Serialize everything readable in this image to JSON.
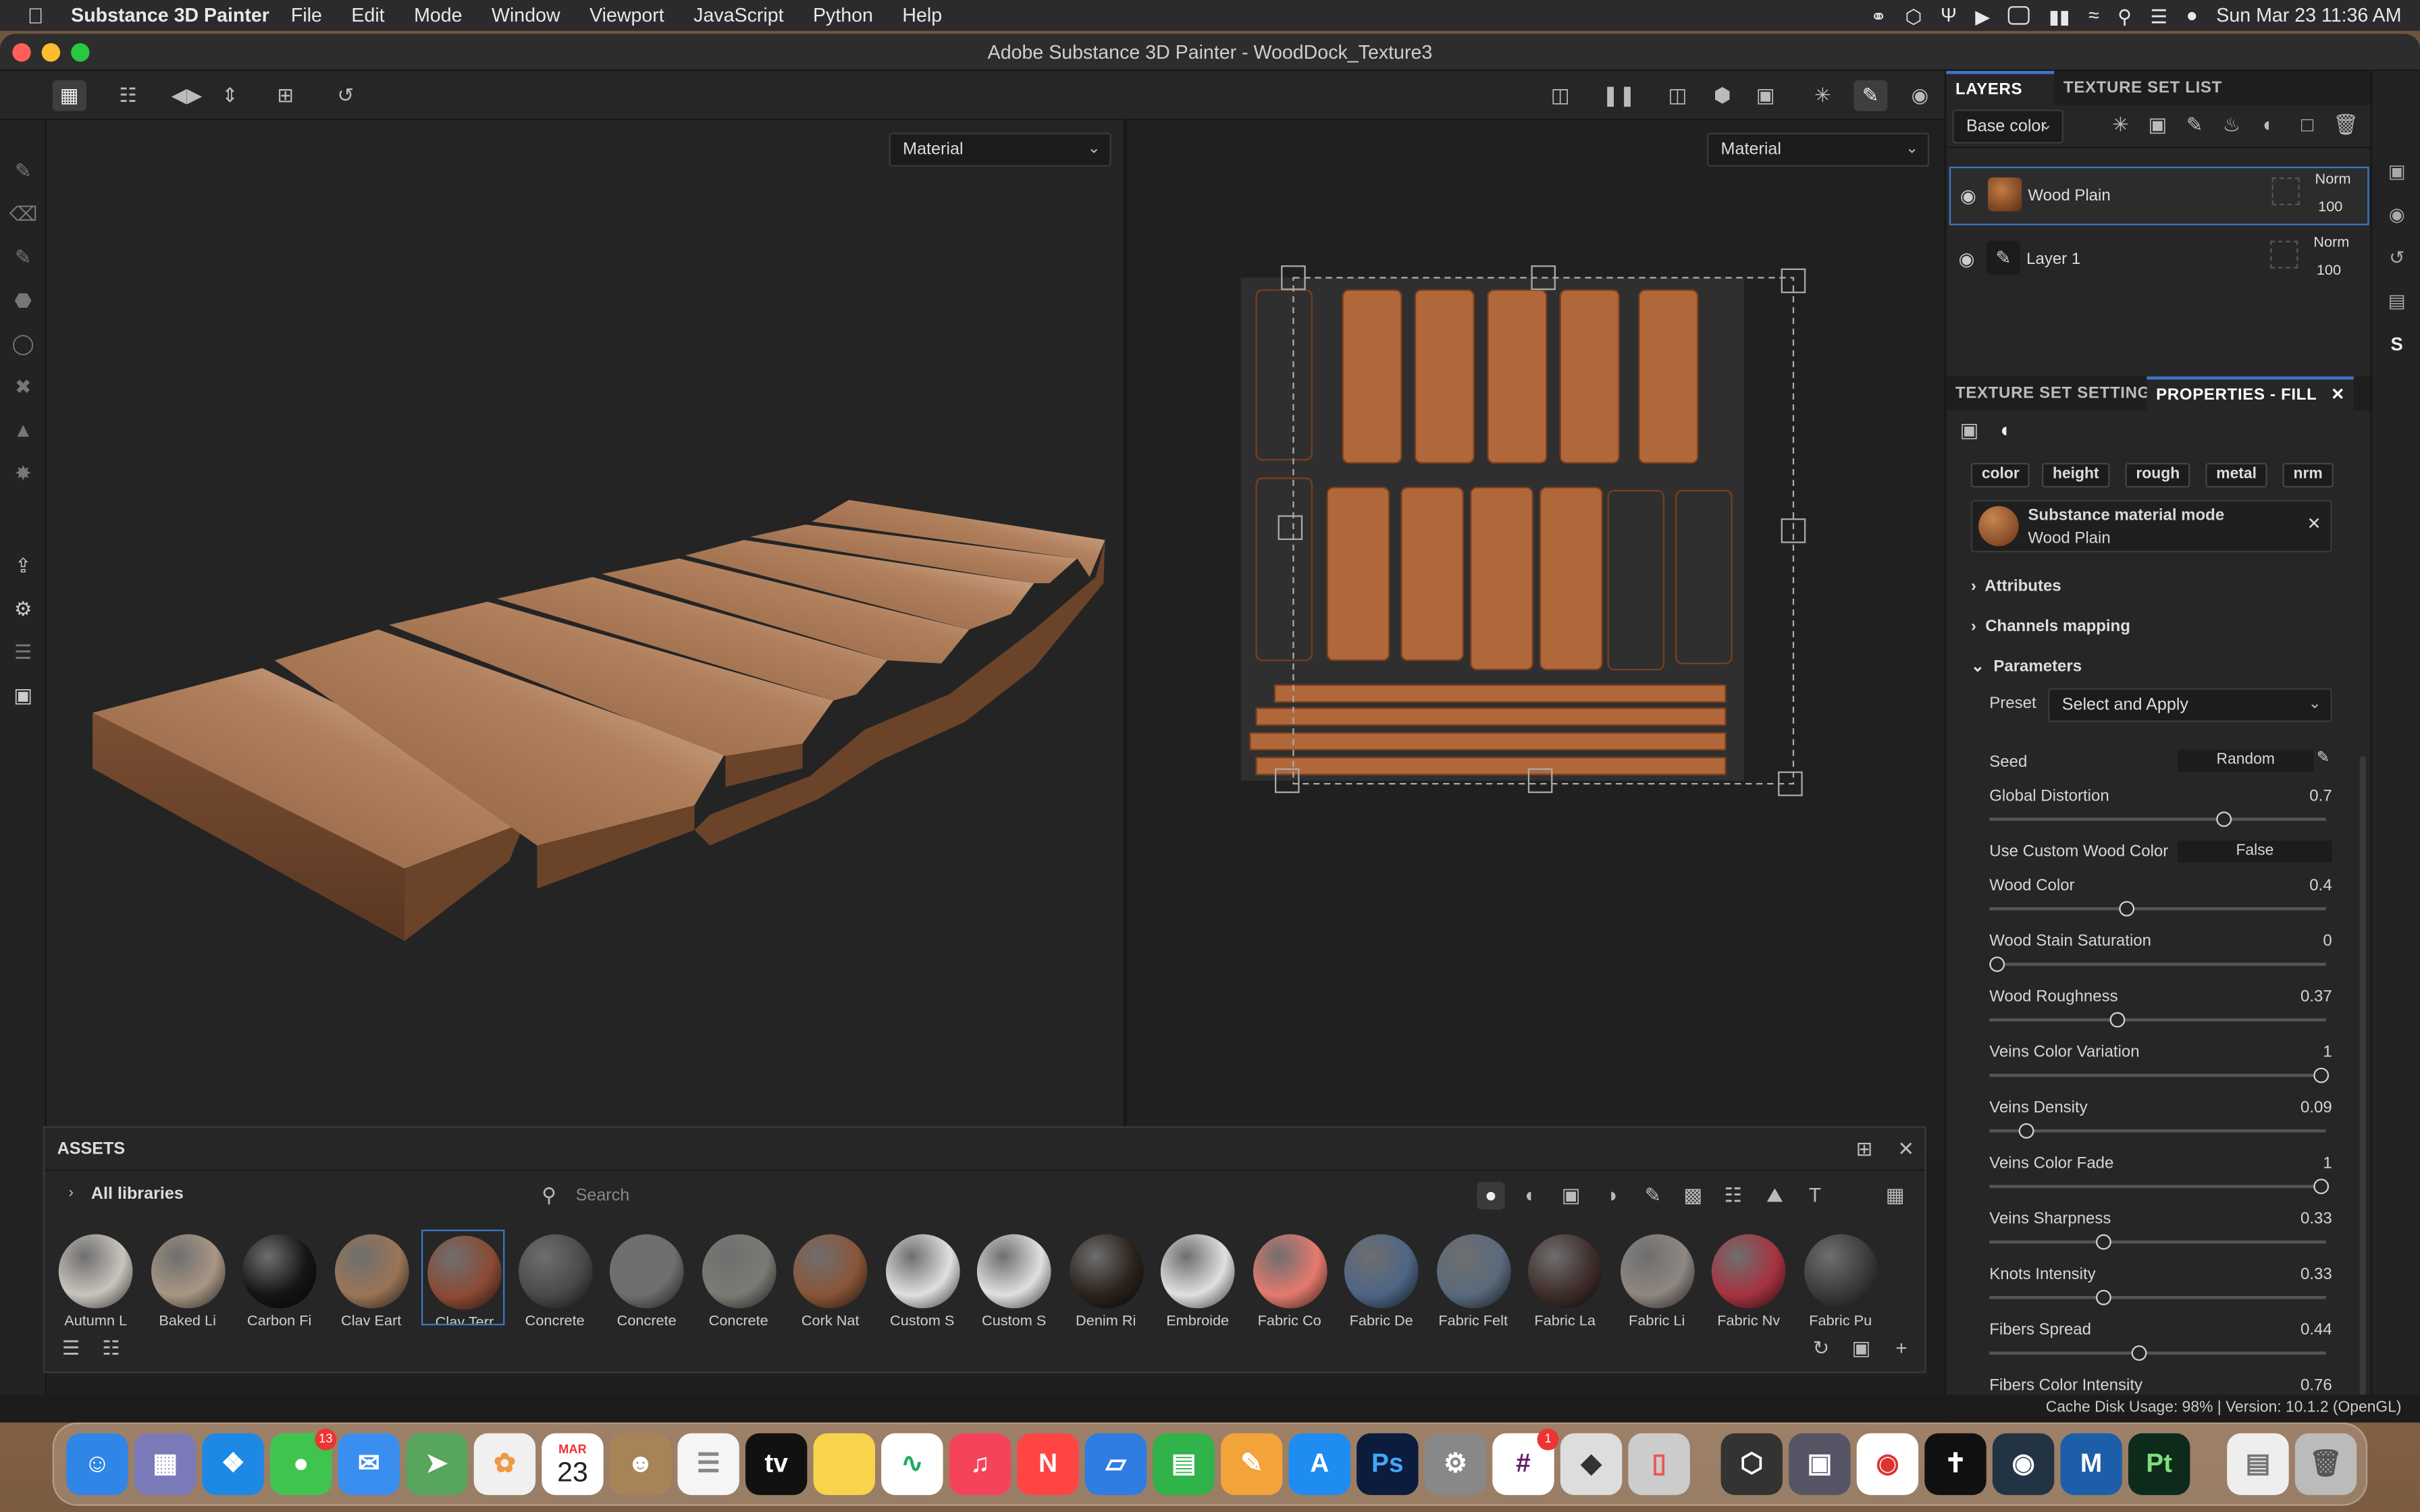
{
  "menubar": {
    "app_name": "Substance 3D Painter",
    "menus": [
      "File",
      "Edit",
      "Mode",
      "Window",
      "Viewport",
      "JavaScript",
      "Python",
      "Help"
    ],
    "datetime": "Sun Mar 23  11:36 AM"
  },
  "window": {
    "title": "Adobe Substance 3D Painter - WoodDock_Texture3"
  },
  "viewport": {
    "left_mode": "Material",
    "right_mode": "Material"
  },
  "layers": {
    "tabs": [
      "LAYERS",
      "TEXTURE SET LIST"
    ],
    "channel": "Base color",
    "items": [
      {
        "name": "Wood Plain",
        "blend": "Norm",
        "opacity": "100"
      },
      {
        "name": "Layer 1",
        "blend": "Norm",
        "opacity": "100"
      }
    ]
  },
  "properties": {
    "tabs": [
      "TEXTURE SET SETTINGS",
      "PROPERTIES - FILL"
    ],
    "channels": [
      "color",
      "height",
      "rough",
      "metal",
      "nrm"
    ],
    "material_mode_label": "Substance material mode",
    "material_name": "Wood Plain",
    "sections": {
      "attributes": "Attributes",
      "channels_mapping": "Channels mapping",
      "parameters": "Parameters"
    },
    "preset_label": "Preset",
    "preset_value": "Select and Apply",
    "seed_label": "Seed",
    "seed_value": "Random",
    "params": [
      {
        "label": "Global Distortion",
        "value": "0.7",
        "frac": 0.7
      },
      {
        "label": "Wood Color",
        "value": "0.4",
        "frac": 0.4
      },
      {
        "label": "Wood Stain Saturation",
        "value": "0",
        "frac": 0
      },
      {
        "label": "Wood Roughness",
        "value": "0.37",
        "frac": 0.37
      },
      {
        "label": "Veins Color Variation",
        "value": "1",
        "frac": 1
      },
      {
        "label": "Veins Density",
        "value": "0.09",
        "frac": 0.09
      },
      {
        "label": "Veins Color Fade",
        "value": "1",
        "frac": 1
      },
      {
        "label": "Veins Sharpness",
        "value": "0.33",
        "frac": 0.33
      },
      {
        "label": "Knots Intensity",
        "value": "0.33",
        "frac": 0.33
      },
      {
        "label": "Fibers Spread",
        "value": "0.44",
        "frac": 0.44
      },
      {
        "label": "Fibers Color Intensity",
        "value": "0.76",
        "frac": 0.76
      }
    ],
    "custom_color": {
      "label": "Use Custom Wood Color",
      "value": "False"
    }
  },
  "assets": {
    "title": "ASSETS",
    "libraries": "All libraries",
    "search_placeholder": "Search",
    "items": [
      {
        "label": "Autumn L",
        "color": "#c9c4bd"
      },
      {
        "label": "Baked Li",
        "color": "#a89684"
      },
      {
        "label": "Carbon Fi",
        "color": "#151515"
      },
      {
        "label": "Clay Eart",
        "color": "#9a7557"
      },
      {
        "label": "Clay Terr",
        "color": "#8b4a34"
      },
      {
        "label": "Concrete",
        "color": "#4a4a4c"
      },
      {
        "label": "Concrete",
        "color": "#6f6f6f"
      },
      {
        "label": "Concrete",
        "color": "#7a7b74"
      },
      {
        "label": "Cork Nat",
        "color": "#8a5538"
      },
      {
        "label": "Custom S",
        "color": "#e0e0e0"
      },
      {
        "label": "Custom S",
        "color": "#e0e0e0"
      },
      {
        "label": "Denim Ri",
        "color": "#2a221c"
      },
      {
        "label": "Embroide",
        "color": "#e0e0e0"
      },
      {
        "label": "Fabric Co",
        "color": "#e57a6e"
      },
      {
        "label": "Fabric De",
        "color": "#4e6584"
      },
      {
        "label": "Fabric Felt",
        "color": "#5a6a7c"
      },
      {
        "label": "Fabric La",
        "color": "#3e2d2a"
      },
      {
        "label": "Fabric Li",
        "color": "#8e8782"
      },
      {
        "label": "Fabric Ny",
        "color": "#a63340"
      },
      {
        "label": "Fabric Pu",
        "color": "#3a3a3a"
      }
    ]
  },
  "status": {
    "text": "Cache Disk Usage:    98% | Version: 10.1.2 (OpenGL)"
  },
  "dock": {
    "calendar_month": "MAR",
    "calendar_day": "23",
    "messages_badge": "13",
    "slack_badge": "1",
    "ps_label": "Ps",
    "pt_label": "Pt",
    "tv_label": "tv"
  }
}
